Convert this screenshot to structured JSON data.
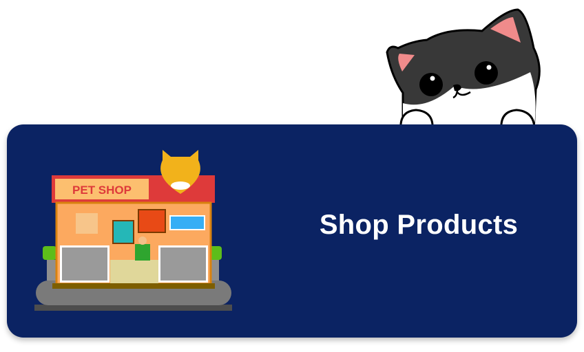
{
  "card": {
    "title": "Shop Products",
    "background_color": "#0b2363",
    "text_color": "#ffffff"
  },
  "illustration": {
    "sign_text": "PET SHOP",
    "mascot": "peeking-cat"
  }
}
